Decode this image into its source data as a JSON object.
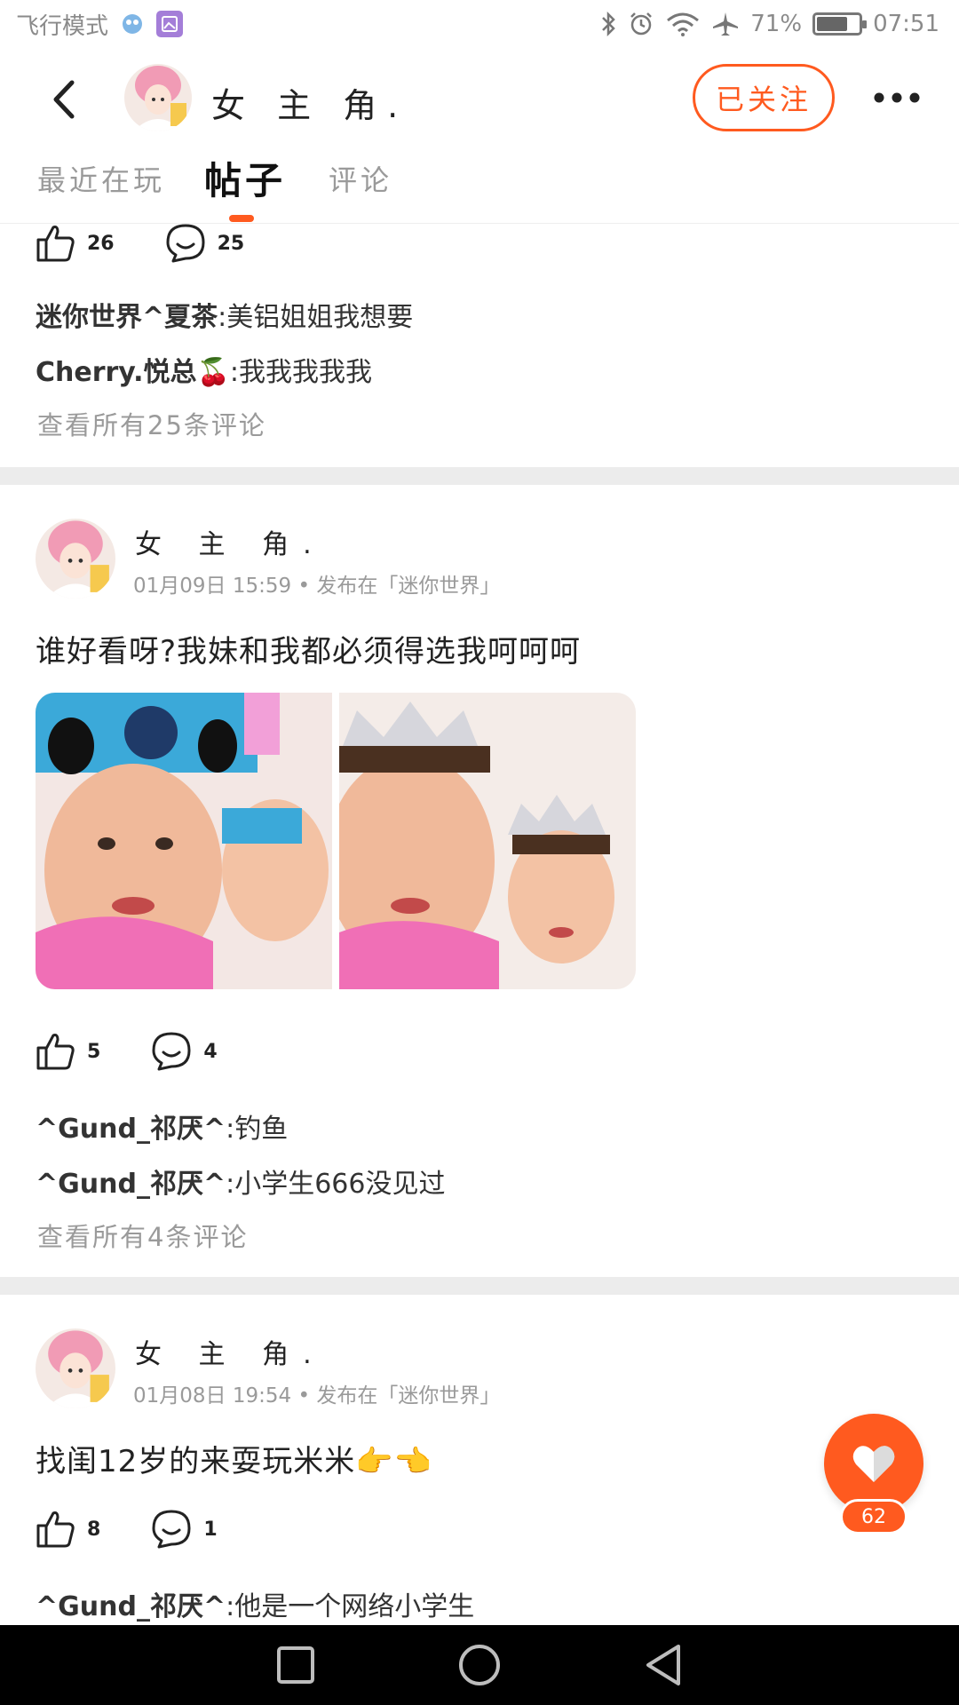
{
  "status_bar": {
    "carrier": "飞行模式",
    "battery": "71%",
    "battery_level": 0.71,
    "time": "07:51"
  },
  "header": {
    "username": "女 主 角.",
    "follow_label": "已关注"
  },
  "tabs": [
    {
      "label": "最近在玩",
      "active": false
    },
    {
      "label": "帖子",
      "active": true
    },
    {
      "label": "评论",
      "active": false
    }
  ],
  "posts": [
    {
      "likes": "26",
      "comments_count": "25",
      "comments": [
        {
          "author": "迷你世界^夏茶",
          "text": ":美铝姐姐我想要"
        },
        {
          "author": "Cherry.悦总🍒",
          "text": ":我我我我我"
        }
      ],
      "view_all": "查看所有25条评论"
    },
    {
      "author": "女 主 角.",
      "date": "01月09日 15:59",
      "published_in": "发布在「迷你世界」",
      "text": "谁好看呀?我妹和我都必须得选我呵呵呵",
      "likes": "5",
      "comments_count": "4",
      "comments": [
        {
          "author": "^Gund_祁厌^",
          "text": ":钓鱼"
        },
        {
          "author": "^Gund_祁厌^",
          "text": ":小学生666没见过"
        }
      ],
      "view_all": "查看所有4条评论"
    },
    {
      "author": "女 主 角.",
      "date": "01月08日 19:54",
      "published_in": "发布在「迷你世界」",
      "text": "找闺12岁的来耍玩米米👉👈",
      "likes": "8",
      "comments_count": "1",
      "comments": [
        {
          "author": "^Gund_祁厌^",
          "text": ":他是一个网络小学生"
        }
      ]
    }
  ],
  "floating_like": {
    "count": "62"
  },
  "colors": {
    "accent": "#ff5a1f",
    "divider": "#ececec",
    "muted_text": "#9a9a9a"
  }
}
